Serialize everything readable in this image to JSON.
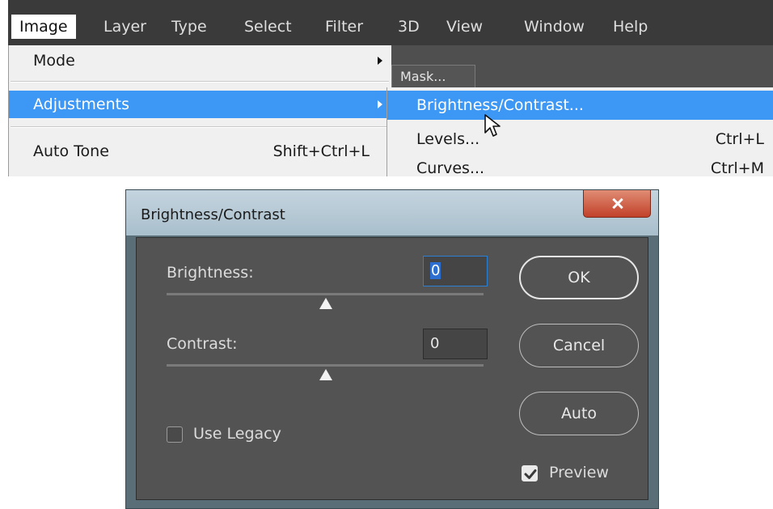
{
  "menubar": {
    "items": [
      "Image",
      "Layer",
      "Type",
      "Select",
      "Filter",
      "3D",
      "View",
      "Window",
      "Help"
    ],
    "active": "Image"
  },
  "panel": {
    "mask_button": "Mask..."
  },
  "image_menu": {
    "items": [
      {
        "label": "Mode",
        "submenu": true
      },
      {
        "label": "Adjustments",
        "submenu": true,
        "highlighted": true
      },
      {
        "label": "Auto Tone",
        "shortcut": "Shift+Ctrl+L"
      }
    ]
  },
  "adjustments_menu": {
    "items": [
      {
        "label": "Brightness/Contrast...",
        "highlighted": true
      },
      {
        "label": "Levels...",
        "shortcut": "Ctrl+L"
      },
      {
        "label": "Curves...",
        "shortcut": "Ctrl+M"
      }
    ]
  },
  "dialog": {
    "title": "Brightness/Contrast",
    "brightness": {
      "label": "Brightness:",
      "value": "0"
    },
    "contrast": {
      "label": "Contrast:",
      "value": "0"
    },
    "buttons": {
      "ok": "OK",
      "cancel": "Cancel",
      "auto": "Auto"
    },
    "use_legacy": {
      "label": "Use Legacy",
      "checked": false
    },
    "preview": {
      "label": "Preview",
      "checked": true
    }
  },
  "colors": {
    "menu_highlight": "#3c97f5",
    "dialog_body": "#535353",
    "focus_border": "#2b7fd4",
    "close_button": "#c2412a"
  },
  "icons": [
    "submenu-arrow-icon",
    "mouse-cursor-icon",
    "close-icon",
    "checkmark-icon"
  ]
}
